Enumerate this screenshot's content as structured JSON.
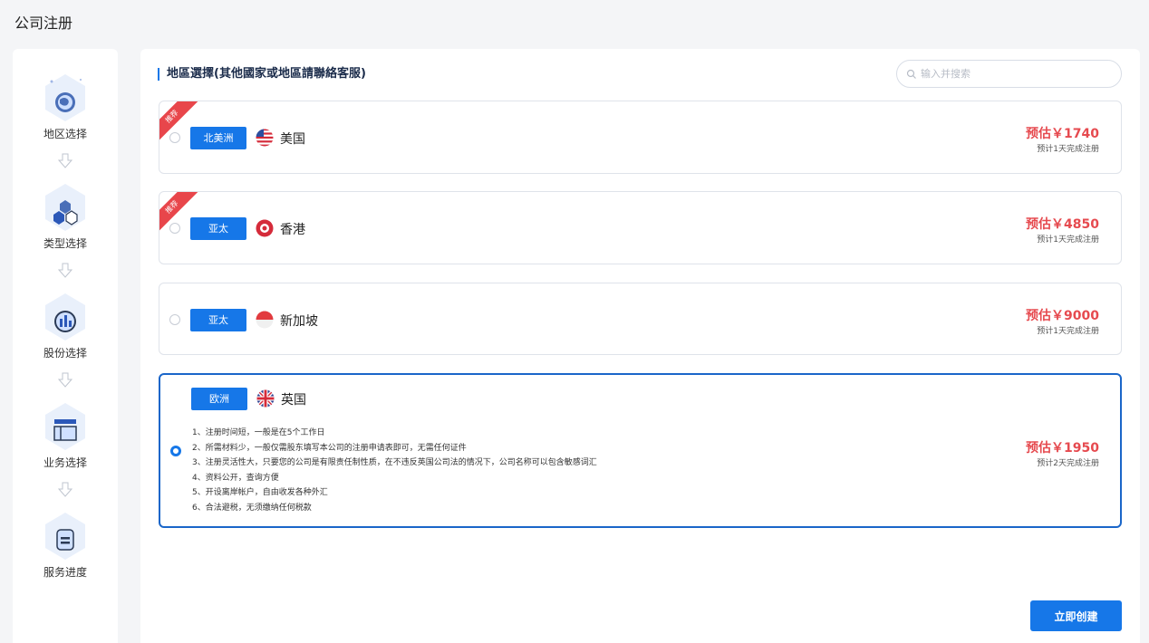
{
  "page": {
    "title": "公司注册"
  },
  "steps": [
    {
      "label": "地区选择",
      "icon": "globe-icon"
    },
    {
      "label": "类型选择",
      "icon": "cubes-icon"
    },
    {
      "label": "股份选择",
      "icon": "bar-chart-icon"
    },
    {
      "label": "业务选择",
      "icon": "layout-icon"
    },
    {
      "label": "服务进度",
      "icon": "document-icon"
    }
  ],
  "section": {
    "title": "地區選擇(其他國家或地區請聯絡客服)"
  },
  "search": {
    "placeholder": "输入并搜索",
    "value": ""
  },
  "options": [
    {
      "badge": "推荐",
      "region": "北美洲",
      "country": "美国",
      "price": "预估￥1740",
      "duration": "预计1天完成注册",
      "flag": "us-flag-icon",
      "selected": false
    },
    {
      "badge": "推荐",
      "region": "亚太",
      "country": "香港",
      "price": "预估￥4850",
      "duration": "预计1天完成注册",
      "flag": "hk-flag-icon",
      "selected": false
    },
    {
      "badge": "",
      "region": "亚太",
      "country": "新加坡",
      "price": "预估￥9000",
      "duration": "预计1天完成注册",
      "flag": "sg-flag-icon",
      "selected": false
    },
    {
      "badge": "",
      "region": "欧洲",
      "country": "英国",
      "price": "预估￥1950",
      "duration": "预计2天完成注册",
      "flag": "uk-flag-icon",
      "selected": true,
      "features": [
        "1、注册时间短，一般是在5个工作日",
        "2、所需材料少，一般仅需股东填写本公司的注册申请表即可，无需任何证件",
        "3、注册灵活性大，只要您的公司是有限责任制性质，在不违反英国公司法的情况下，公司名称可以包含敏感词汇",
        "4、资料公开，查询方便",
        "5、开设离岸帐户，自由收发各种外汇",
        "6、合法避税，无须缴纳任何税款"
      ]
    }
  ],
  "actions": {
    "create_label": "立即创建"
  },
  "colors": {
    "primary": "#1677e8",
    "price": "#e64a4f",
    "ribbon": "#e8464b",
    "selected_border": "#1a66c9"
  }
}
